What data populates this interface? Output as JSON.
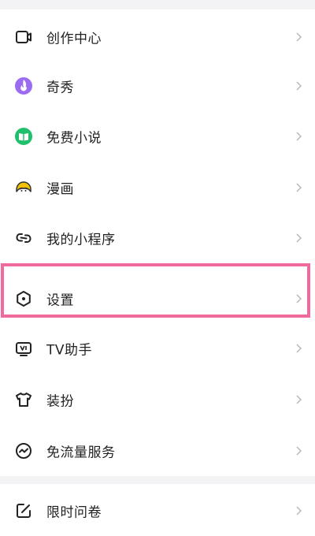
{
  "menu": {
    "items": [
      {
        "label": "创作中心",
        "icon": "creation-center-icon"
      },
      {
        "label": "奇秀",
        "icon": "qixiu-icon"
      },
      {
        "label": "免费小说",
        "icon": "free-novel-icon"
      },
      {
        "label": "漫画",
        "icon": "comic-icon"
      },
      {
        "label": "我的小程序",
        "icon": "mini-program-icon"
      },
      {
        "label": "设置",
        "icon": "settings-icon"
      },
      {
        "label": "TV助手",
        "icon": "tv-assistant-icon"
      },
      {
        "label": "装扮",
        "icon": "dress-up-icon"
      },
      {
        "label": "免流量服务",
        "icon": "data-free-icon"
      }
    ],
    "items2": [
      {
        "label": "限时问卷",
        "icon": "survey-icon"
      }
    ]
  },
  "colors": {
    "highlight": "#f06b9d",
    "qixiu": "#9b6cf2",
    "novel": "#1fbf6b",
    "comic": "#f2c200",
    "chevron": "#b8b8b8",
    "divider": "#f3f3f5"
  }
}
